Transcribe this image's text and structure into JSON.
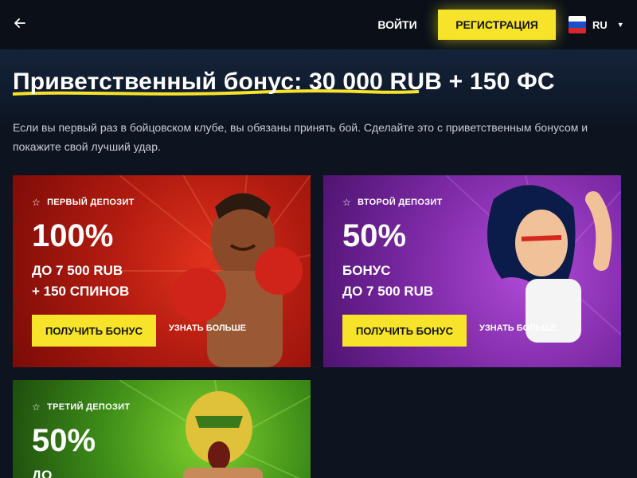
{
  "header": {
    "back_icon": "arrow-left-icon",
    "login_label": "ВОЙТИ",
    "register_label": "РЕГИСТРАЦИЯ",
    "language_code": "RU",
    "language_flag": "flag-ru-icon",
    "accent_color": "#f6e32a"
  },
  "hero": {
    "title": "Приветственный бонус: 30 000 RUB + 150 ФС",
    "description": "Если вы первый раз в бойцовском клубе, вы обязаны принять бой. Сделайте это с приветственным бонусом и покажите свой лучший удар."
  },
  "cards": [
    {
      "label": "ПЕРВЫЙ ДЕПОЗИТ",
      "percent": "100%",
      "details": "ДО 7 500 RUB\n+ 150 СПИНОВ",
      "button": "ПОЛУЧИТЬ БОНУС",
      "link": "УЗНАТЬ БОЛЬШЕ",
      "color": "#c4231a"
    },
    {
      "label": "ВТОРОЙ ДЕПОЗИТ",
      "percent": "50%",
      "details": "БОНУС\nДО 7 500 RUB",
      "button": "ПОЛУЧИТЬ БОНУС",
      "link": "УЗНАТЬ БОЛЬШЕ",
      "color": "#8b35b8"
    },
    {
      "label": "ТРЕТИЙ ДЕПОЗИТ",
      "percent": "50%",
      "details": "ДО",
      "color": "#4a9a1c"
    }
  ]
}
